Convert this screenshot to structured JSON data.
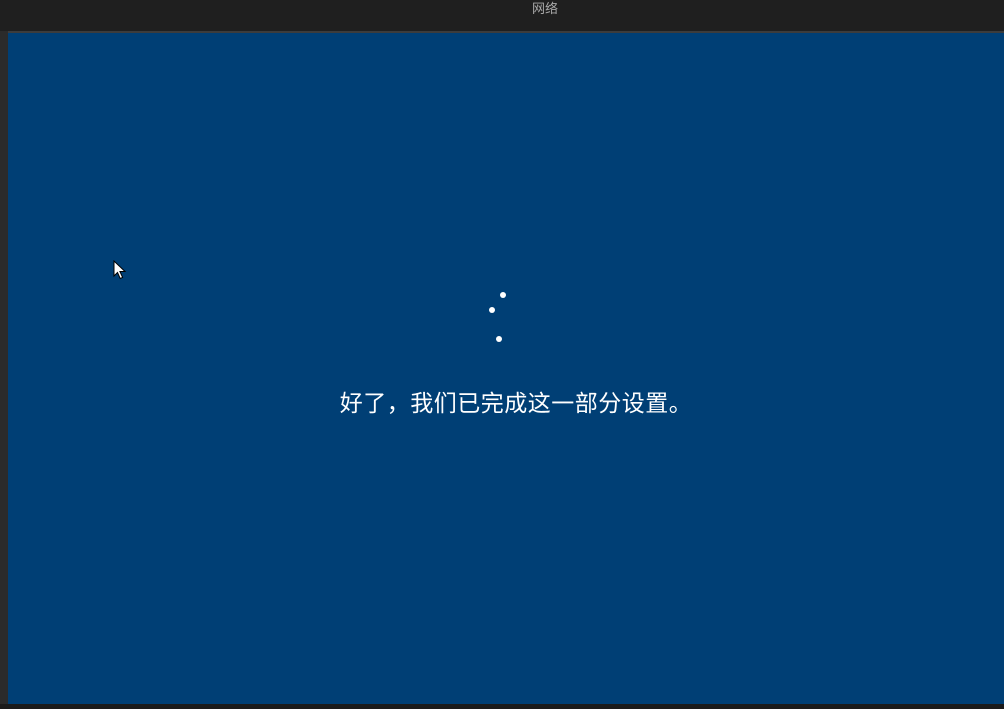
{
  "header": {
    "tabs": [
      {
        "label": "网络",
        "active": true
      }
    ]
  },
  "main": {
    "message": "好了，我们已完成这一部分设置。",
    "background_color": "#003f75",
    "spinner": {
      "type": "loading-dots",
      "visible_dots": 3
    }
  },
  "colors": {
    "accent": "#ffffff",
    "tab_text": "#a9a9a9",
    "topbar": "#1f1f1f"
  }
}
